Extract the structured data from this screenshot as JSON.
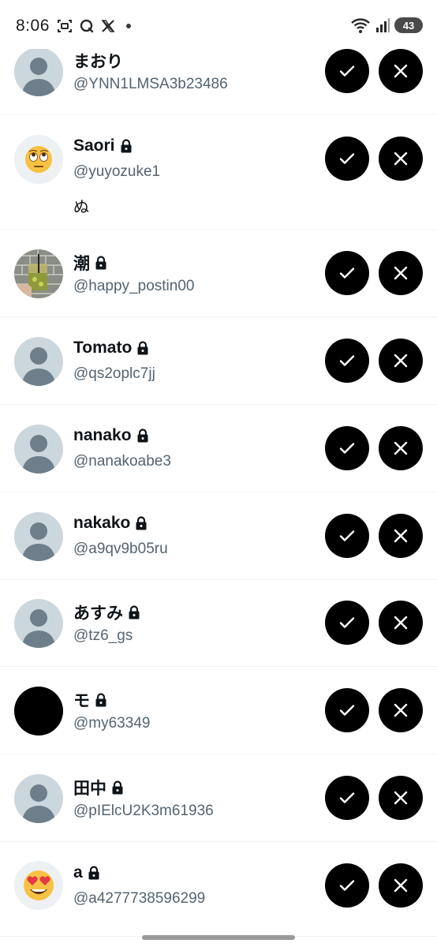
{
  "status_bar": {
    "time": "8:06",
    "left_icons": [
      "screenshot-icon",
      "search-app-icon",
      "x-logo-icon",
      "notification-dot"
    ],
    "right_icons": [
      "wifi-icon",
      "signal-icon"
    ],
    "battery": "43"
  },
  "requests": [
    {
      "name": "まおり",
      "handle": "@YNN1LMSA3b23486",
      "locked": false,
      "bio": "",
      "avatar": "default"
    },
    {
      "name": "Saori",
      "handle": "@yuyozuke1",
      "locked": true,
      "bio": "ぬ",
      "avatar": "emoji-eyeroll"
    },
    {
      "name": "潮",
      "handle": "@happy_postin00",
      "locked": true,
      "bio": "",
      "avatar": "photo-drink"
    },
    {
      "name": "Tomato",
      "handle": "@qs2oplc7jj",
      "locked": true,
      "bio": "",
      "avatar": "default"
    },
    {
      "name": "nanako",
      "handle": "@nanakoabe3",
      "locked": true,
      "bio": "",
      "avatar": "default"
    },
    {
      "name": "nakako",
      "handle": "@a9qv9b05ru",
      "locked": true,
      "bio": "",
      "avatar": "default"
    },
    {
      "name": "あすみ",
      "handle": "@tz6_gs",
      "locked": true,
      "bio": "",
      "avatar": "default"
    },
    {
      "name": "モ",
      "handle": "@my63349",
      "locked": true,
      "bio": "",
      "avatar": "black"
    },
    {
      "name": "田中",
      "handle": "@pIElcU2K3m61936",
      "locked": true,
      "bio": "",
      "avatar": "default"
    },
    {
      "name": "a",
      "handle": "@a4277738596299",
      "locked": true,
      "bio": "",
      "avatar": "emoji-hearteyes"
    }
  ],
  "actions": {
    "accept_icon": "check-icon",
    "decline_icon": "close-icon"
  },
  "colors": {
    "button_bg": "#000000",
    "handle_text": "#536471",
    "divider": "#eff3f4"
  }
}
